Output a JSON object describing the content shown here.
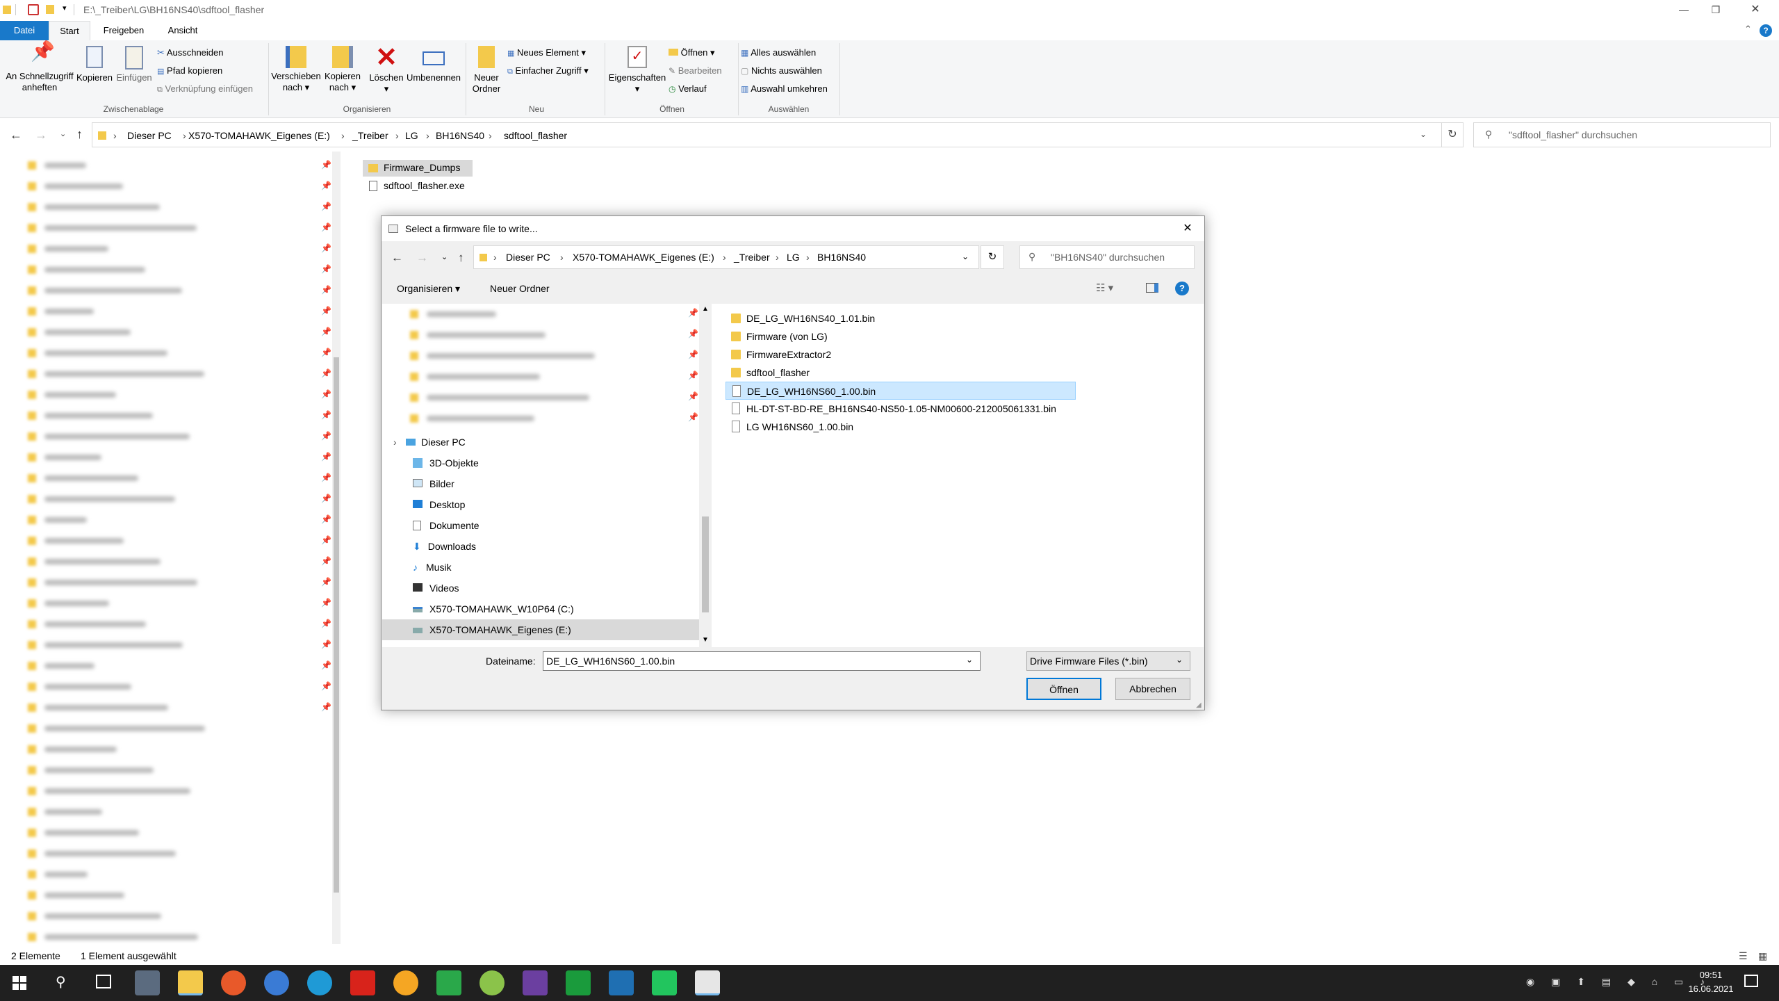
{
  "explorer": {
    "title_path": "E:\\_Treiber\\LG\\BH16NS40\\sdftool_flasher",
    "tabs": [
      "Datei",
      "Start",
      "Freigeben",
      "Ansicht"
    ],
    "ribbon": {
      "pin_quick": "An Schnellzugriff\nanheften",
      "copy": "Kopieren",
      "paste": "Einfügen",
      "cut": "Ausschneiden",
      "copy_path": "Pfad kopieren",
      "paste_shortcut": "Verknüpfung einfügen",
      "group_clipboard": "Zwischenablage",
      "move_to": "Verschieben\nnach ▾",
      "copy_to": "Kopieren\nnach ▾",
      "delete": "Löschen\n▾",
      "rename": "Umbenennen",
      "group_organize": "Organisieren",
      "new_folder": "Neuer\nOrdner",
      "new_item": "Neues Element ▾",
      "easy_access": "Einfacher Zugriff ▾",
      "group_new": "Neu",
      "properties": "Eigenschaften\n▾",
      "open": "Öffnen ▾",
      "edit": "Bearbeiten",
      "history": "Verlauf",
      "group_open": "Öffnen",
      "select_all": "Alles auswählen",
      "select_none": "Nichts auswählen",
      "invert": "Auswahl umkehren",
      "group_select": "Auswählen"
    },
    "breadcrumb": [
      "Dieser PC",
      "X570-TOMAHAWK_Eigenes (E:)",
      "_Treiber",
      "LG",
      "BH16NS40",
      "sdftool_flasher"
    ],
    "search_placeholder": "\"sdftool_flasher\" durchsuchen",
    "files": [
      "Firmware_Dumps",
      "sdftool_flasher.exe"
    ],
    "status_count": "2 Elemente",
    "status_selected": "1 Element ausgewählt"
  },
  "dialog": {
    "title": "Select a firmware file to write...",
    "breadcrumb": [
      "Dieser PC",
      "X570-TOMAHAWK_Eigenes (E:)",
      "_Treiber",
      "LG",
      "BH16NS40"
    ],
    "search_placeholder": "\"BH16NS40\" durchsuchen",
    "organize": "Organisieren ▾",
    "new_folder": "Neuer Ordner",
    "nav": {
      "this_pc": "Dieser PC",
      "items": [
        "3D-Objekte",
        "Bilder",
        "Desktop",
        "Dokumente",
        "Downloads",
        "Musik",
        "Videos",
        "X570-TOMAHAWK_W10P64 (C:)",
        "X570-TOMAHAWK_Eigenes (E:)"
      ]
    },
    "files": [
      {
        "name": "DE_LG_WH16NS40_1.01.bin",
        "type": "folder"
      },
      {
        "name": "Firmware (von LG)",
        "type": "folder"
      },
      {
        "name": "FirmwareExtractor2",
        "type": "folder"
      },
      {
        "name": "sdftool_flasher",
        "type": "folder"
      },
      {
        "name": "DE_LG_WH16NS60_1.00.bin",
        "type": "file",
        "selected": true
      },
      {
        "name": "HL-DT-ST-BD-RE_BH16NS40-NS50-1.05-NM00600-212005061331.bin",
        "type": "file"
      },
      {
        "name": "LG WH16NS60_1.00.bin",
        "type": "file"
      }
    ],
    "filename_label": "Dateiname:",
    "filename_value": "DE_LG_WH16NS60_1.00.bin",
    "filter": "Drive Firmware Files (*.bin)",
    "open_btn": "Öffnen",
    "cancel_btn": "Abbrechen"
  },
  "taskbar": {
    "time": "09:51",
    "date": "16.06.2021"
  },
  "colors": {
    "accent": "#0063b1",
    "selection": "#cce8ff",
    "folder": "#f3c94b",
    "taskbar": "#202020"
  }
}
